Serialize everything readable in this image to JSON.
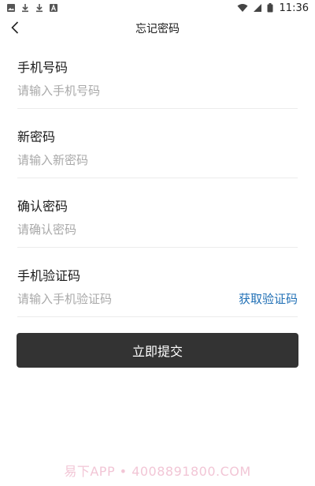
{
  "status_bar": {
    "time": "11:36",
    "left_icons": [
      "image-icon",
      "download-icon",
      "download-icon",
      "a-box-icon"
    ],
    "right_icons": [
      "wifi-icon",
      "signal-icon",
      "battery-icon"
    ]
  },
  "nav": {
    "title": "忘记密码",
    "back_icon": "chevron-left-icon"
  },
  "form": {
    "phone": {
      "label": "手机号码",
      "placeholder": "请输入手机号码",
      "value": ""
    },
    "new_password": {
      "label": "新密码",
      "placeholder": "请输入新密码",
      "value": ""
    },
    "confirm_password": {
      "label": "确认密码",
      "placeholder": "请确认密码",
      "value": ""
    },
    "sms_code": {
      "label": "手机验证码",
      "placeholder": "请输入手机验证码",
      "value": "",
      "get_code_label": "获取验证码"
    }
  },
  "submit_label": "立即提交",
  "watermark": "易下APP • 4008891800.COM",
  "colors": {
    "link": "#1f6fb5",
    "button_bg": "#333333",
    "button_text": "#ffffff",
    "placeholder": "#a9a9a9",
    "divider": "#ececec"
  }
}
